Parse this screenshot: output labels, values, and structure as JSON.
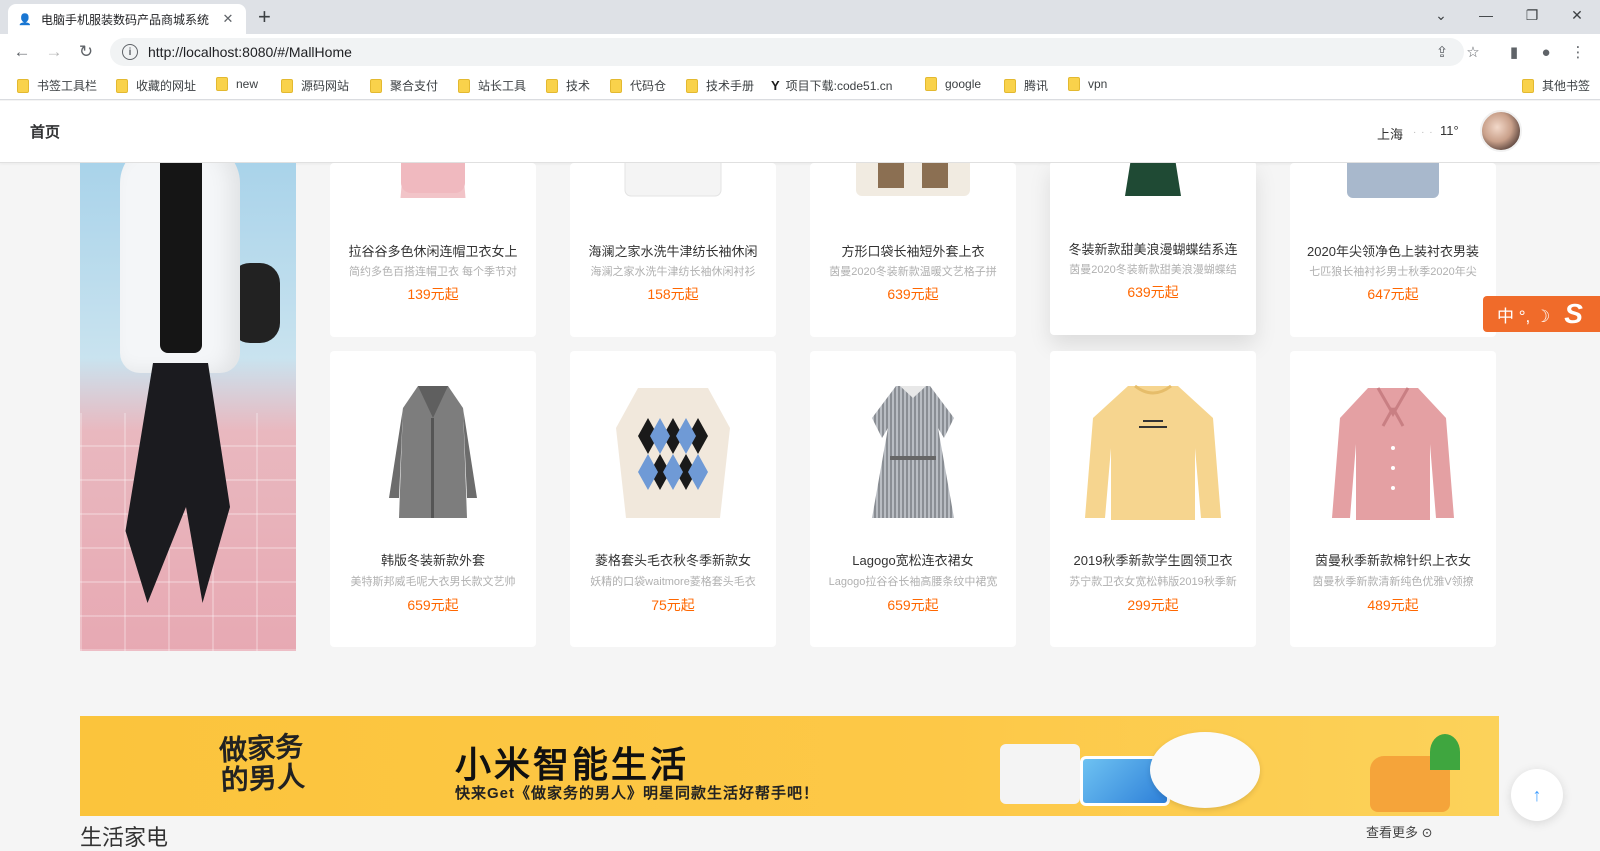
{
  "browser": {
    "tab_title": "电脑手机服装数码产品商城系统",
    "url": "http://localhost:8080/#/MallHome",
    "bookmarks": [
      "书签工具栏",
      "收藏的网址",
      "new",
      "源码网站",
      "聚合支付",
      "站长工具",
      "技术",
      "代码仓",
      "技术手册",
      "项目下载:code51.cn",
      "google",
      "腾讯",
      "vpn"
    ],
    "other_bookmarks": "其他书签"
  },
  "header": {
    "home": "首页",
    "weather": {
      "city": "上海",
      "temp": "11°"
    }
  },
  "products_row1": [
    {
      "name": "拉谷谷多色休闲连帽卫衣女上",
      "desc": "简约多色百搭连帽卫衣 每个季节对",
      "price": "139元起"
    },
    {
      "name": "海澜之家水洗牛津纺长袖休闲",
      "desc": "海澜之家水洗牛津纺长袖休闲衬衫",
      "price": "158元起"
    },
    {
      "name": "方形口袋长袖短外套上衣",
      "desc": "茵曼2020冬装新款温暖文艺格子拼",
      "price": "639元起"
    },
    {
      "name": "冬装新款甜美浪漫蝴蝶结系连",
      "desc": "茵曼2020冬装新款甜美浪漫蝴蝶结",
      "price": "639元起"
    },
    {
      "name": "2020年尖领净色上装衬衣男装",
      "desc": "七匹狼长袖衬衫男士秋季2020年尖",
      "price": "647元起"
    }
  ],
  "products_row2": [
    {
      "name": "韩版冬装新款外套",
      "desc": "美特斯邦威毛呢大衣男长款文艺帅",
      "price": "659元起"
    },
    {
      "name": "菱格套头毛衣秋冬季新款女",
      "desc": "妖精的口袋waitmore菱格套头毛衣",
      "price": "75元起"
    },
    {
      "name": "Lagogo宽松连衣裙女",
      "desc": "Lagogo拉谷谷长袖高腰条纹中裙宽",
      "price": "659元起"
    },
    {
      "name": "2019秋季新款学生圆领卫衣",
      "desc": "苏宁款卫衣女宽松韩版2019秋季新",
      "price": "299元起"
    },
    {
      "name": "茵曼秋季新款棉针织上衣女",
      "desc": "茵曼秋季新款清新纯色优雅V领撩",
      "price": "489元起"
    }
  ],
  "banner": {
    "logo_line1": "做家务",
    "logo_line2": "的男人",
    "title": "小米智能生活",
    "subtitle": "快来Get《做家务的男人》明星同款生活好帮手吧！"
  },
  "section": {
    "title": "生活家电",
    "more": "查看更多 ⊙"
  },
  "ime": {
    "label": "中 °, ☽",
    "logo": "S"
  },
  "colors": {
    "price": "#ff6700",
    "banner": "#fbc43c",
    "ime": "#f06b2a"
  }
}
